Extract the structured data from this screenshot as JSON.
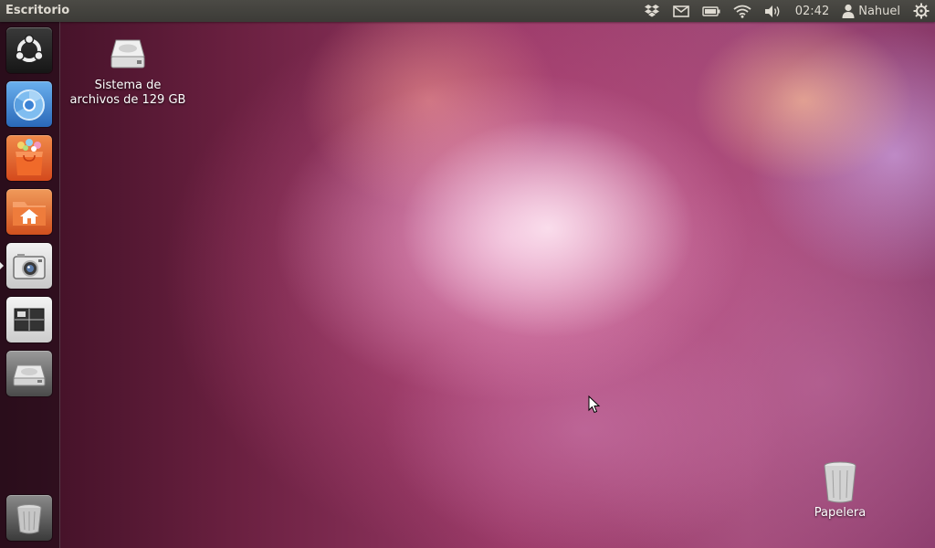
{
  "panel": {
    "title": "Escritorio",
    "clock": "02:42",
    "user": "Nahuel",
    "indicators": [
      "dropbox-icon",
      "mail-icon",
      "battery-icon",
      "wifi-icon",
      "volume-icon",
      "clock",
      "user-icon",
      "session-gear-icon"
    ]
  },
  "launcher": {
    "items": [
      {
        "name": "dash-home",
        "icon": "ubuntu-logo-icon"
      },
      {
        "name": "chromium",
        "icon": "chromium-icon"
      },
      {
        "name": "software-center",
        "icon": "shopping-bag-icon"
      },
      {
        "name": "home-folder",
        "icon": "home-folder-icon"
      },
      {
        "name": "shotwell",
        "icon": "camera-icon",
        "running": true
      },
      {
        "name": "workspaces",
        "icon": "workspace-switcher-icon"
      },
      {
        "name": "filesystem",
        "icon": "hard-drive-icon"
      },
      {
        "name": "trash",
        "icon": "trash-icon"
      }
    ]
  },
  "desktop": {
    "filesystem_label_line1": "Sistema de",
    "filesystem_label_line2": "archivos de 129 GB",
    "trash_label": "Papelera"
  },
  "colors": {
    "panel_bg": "#3c3b37",
    "panel_text": "#dfdbd2",
    "accent_orange": "#e8542a",
    "chromium_blue": "#4a8ad6"
  }
}
